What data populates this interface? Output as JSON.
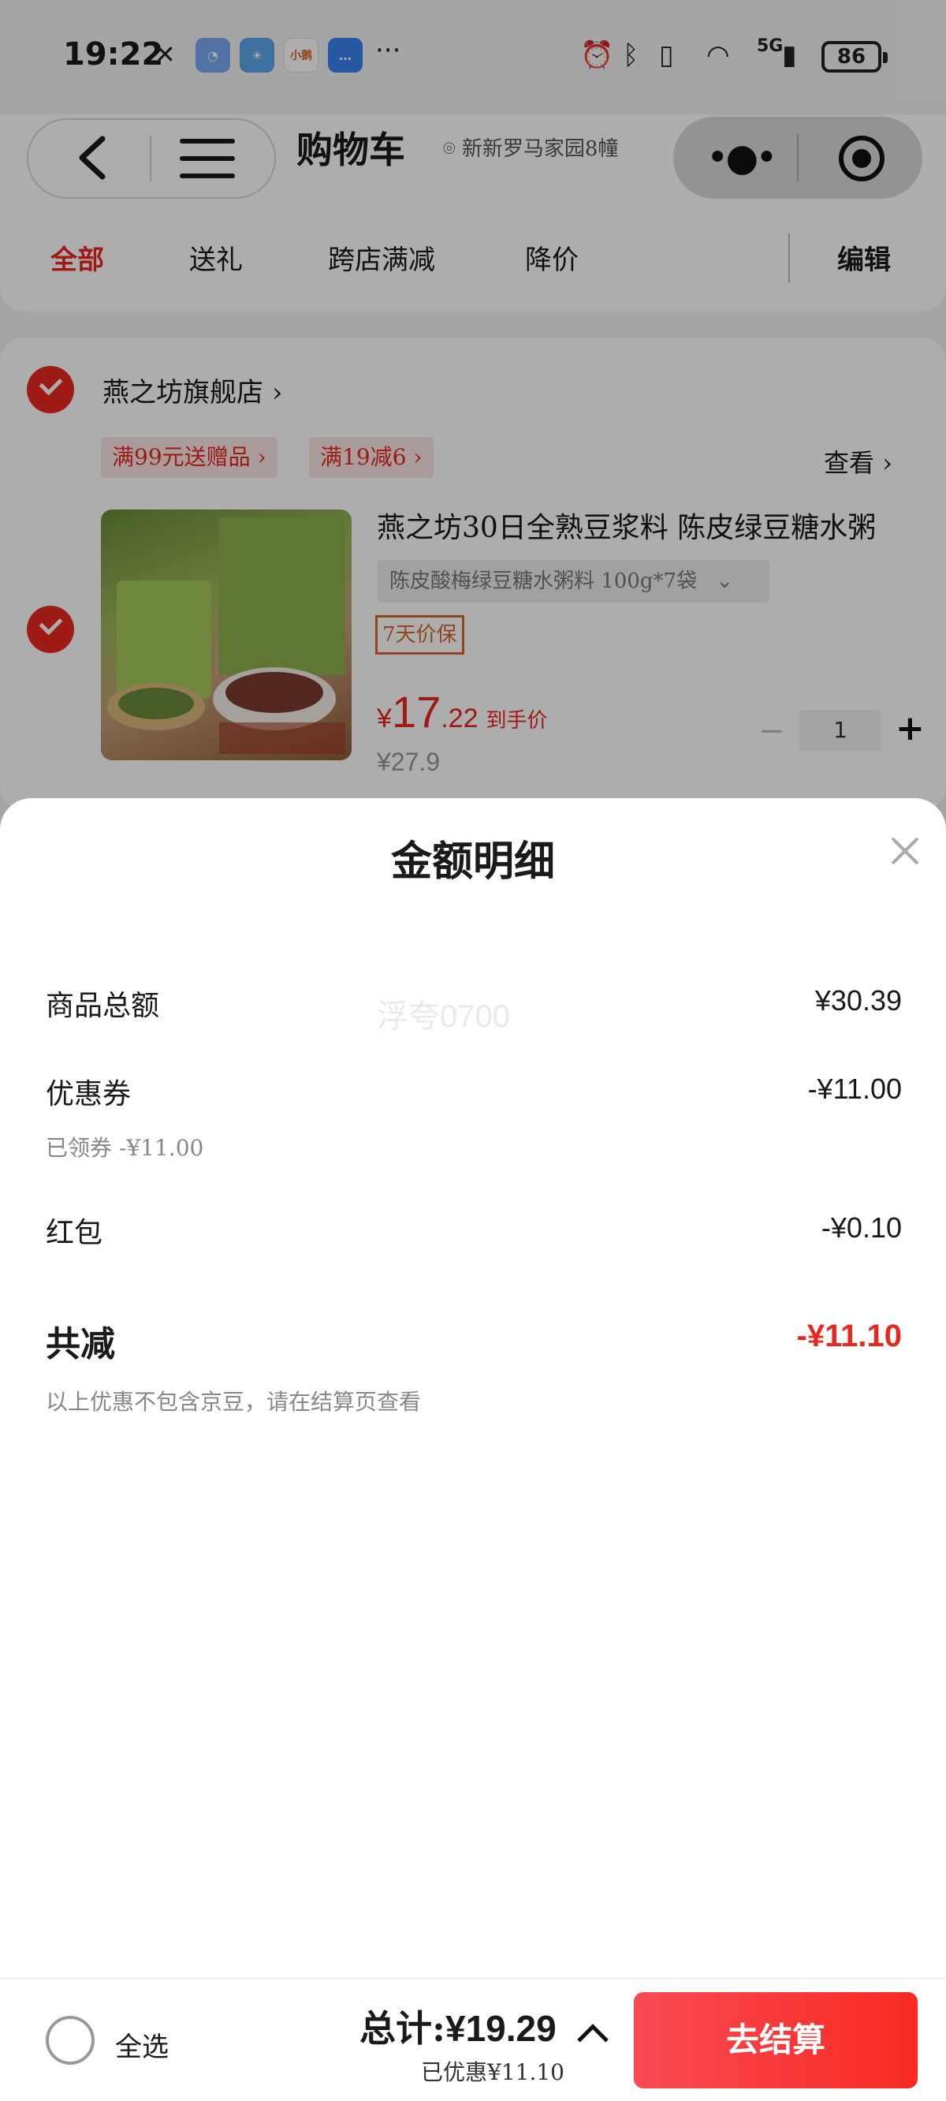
{
  "status_bar": {
    "time": "19:22",
    "battery": "86",
    "network": "5G",
    "app_icon_label": "小鹅"
  },
  "header": {
    "title": "购物车",
    "location": "新新罗马家园8幢",
    "tabs": [
      {
        "label": "全部",
        "active": true
      },
      {
        "label": "送礼",
        "active": false
      },
      {
        "label": "跨店满减",
        "active": false
      },
      {
        "label": "降价",
        "active": false
      }
    ],
    "edit_label": "编辑"
  },
  "shop": {
    "name": "燕之坊旗舰店",
    "promos": [
      "满99元送赠品",
      "满19减6"
    ],
    "view_label": "查看"
  },
  "product": {
    "title": "燕之坊30日全熟豆浆料 陈皮绿豆糖水粥",
    "spec": "陈皮酸梅绿豆糖水粥料 100g*7袋",
    "badge": "7天价保",
    "price_symbol": "¥",
    "price_int": "17",
    "price_dec": ".22",
    "price_note": "到手价",
    "original_price": "¥27.9",
    "quantity": "1"
  },
  "sheet": {
    "title": "金额明细",
    "watermark": "浮夸0700",
    "rows": [
      {
        "label": "商品总额",
        "value": "¥30.39"
      },
      {
        "label": "优惠券",
        "value": "-¥11.00",
        "sub": "已领券 -¥11.00"
      },
      {
        "label": "红包",
        "value": "-¥0.10"
      }
    ],
    "total_label": "共减",
    "total_value": "-¥11.10",
    "note": "以上优惠不包含京豆，请在结算页查看"
  },
  "bottom": {
    "select_all": "全选",
    "total_prefix": "总计:",
    "total_amount": "¥19.29",
    "discount": "已优惠¥11.10",
    "checkout": "去结算"
  },
  "colors": {
    "accent": "#e8281e",
    "checkout_start": "#f94a54",
    "checkout_end": "#f82a22"
  }
}
